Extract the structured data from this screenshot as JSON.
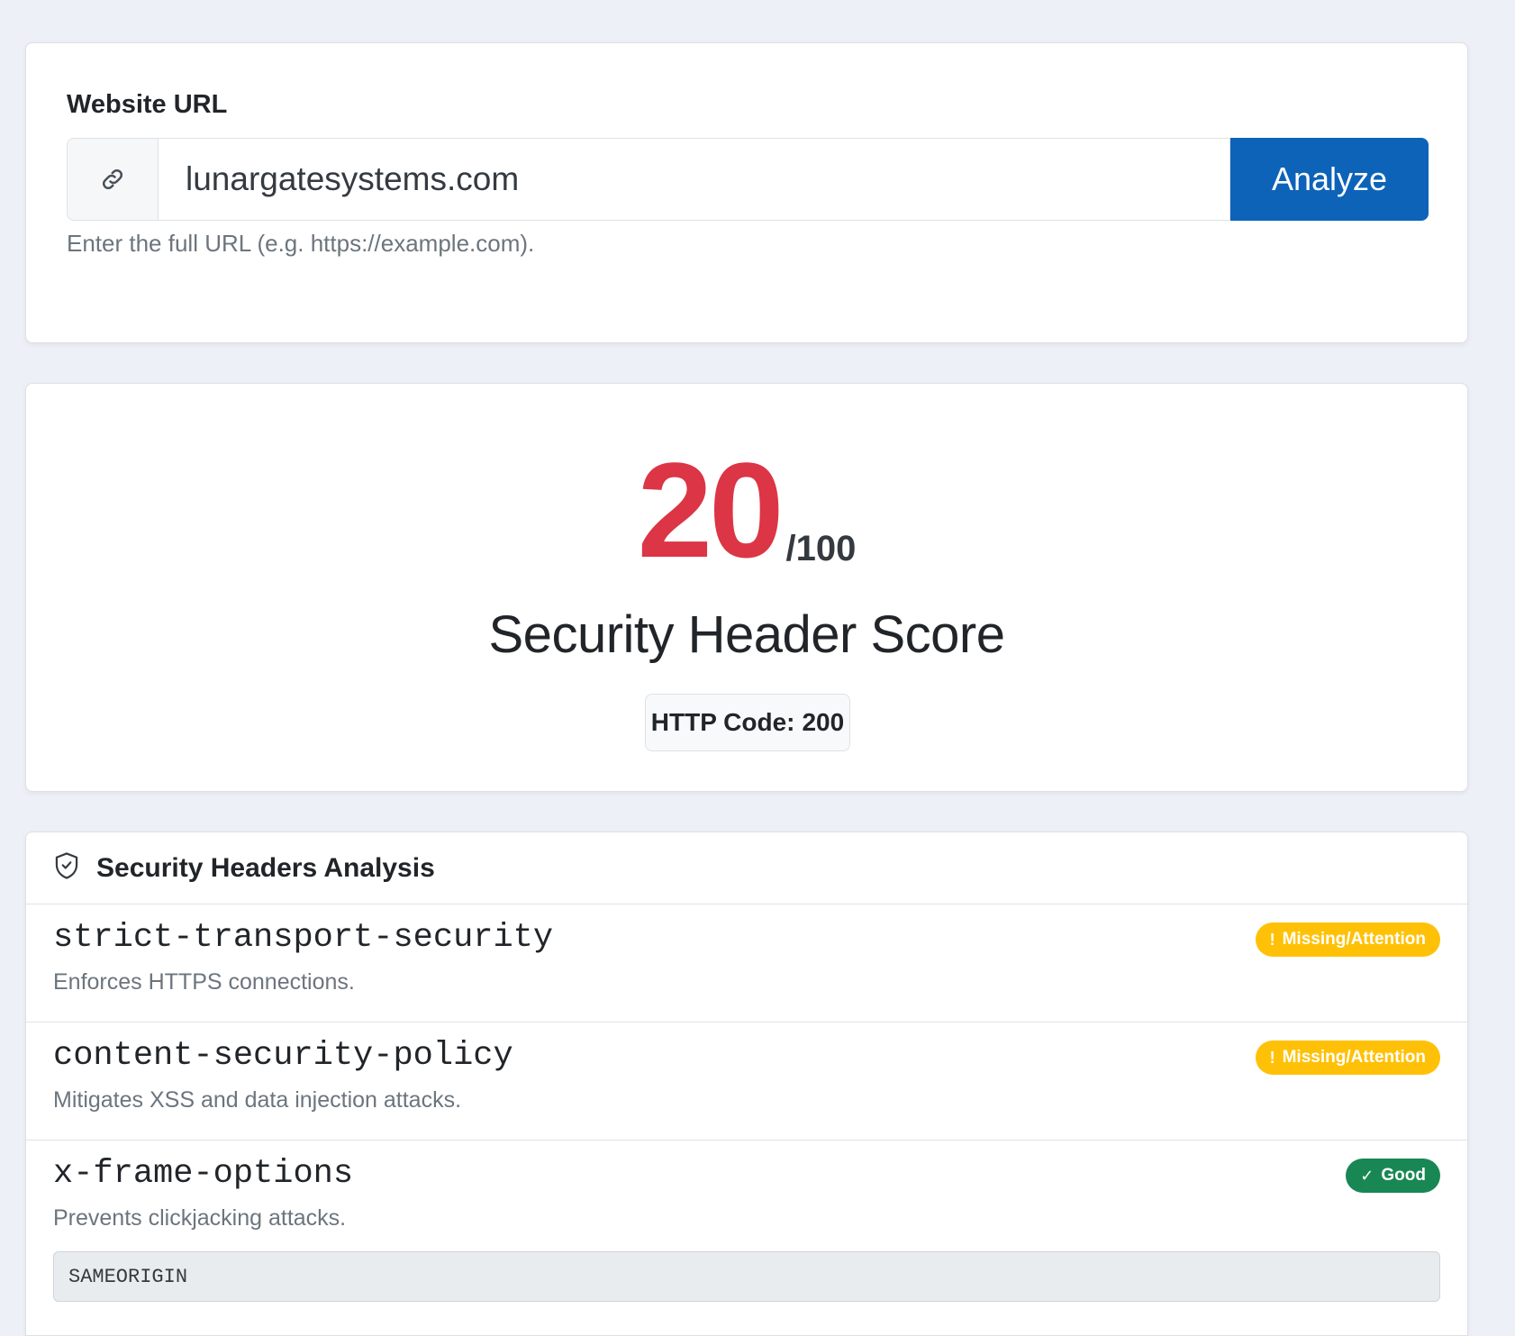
{
  "url_form": {
    "label": "Website URL",
    "input_value": "lunargatesystems.com",
    "input_placeholder": "",
    "prepend_icon": "link-icon",
    "button_label": "Analyze",
    "help_text": "Enter the full URL (e.g. https://example.com).",
    "button_color": "#0d63b8"
  },
  "score": {
    "value": "20",
    "max": "/100",
    "title": "Security Header Score",
    "http_label": "HTTP Code:",
    "http_value": "200",
    "score_color": "#dc3545"
  },
  "analysis": {
    "title": "Security Headers Analysis",
    "title_icon": "shield-check-icon",
    "headers": [
      {
        "name": "strict-transport-security",
        "description": "Enforces HTTPS connections.",
        "status": "Missing/Attention",
        "status_icon": "!",
        "status_color": "#ffc107"
      },
      {
        "name": "content-security-policy",
        "description": "Mitigates XSS and data injection attacks.",
        "status": "Missing/Attention",
        "status_icon": "!",
        "status_color": "#ffc107"
      },
      {
        "name": "x-frame-options",
        "description": "Prevents clickjacking attacks.",
        "status": "Good",
        "status_icon": "✓",
        "status_color": "#198754",
        "value": "SAMEORIGIN"
      }
    ]
  }
}
